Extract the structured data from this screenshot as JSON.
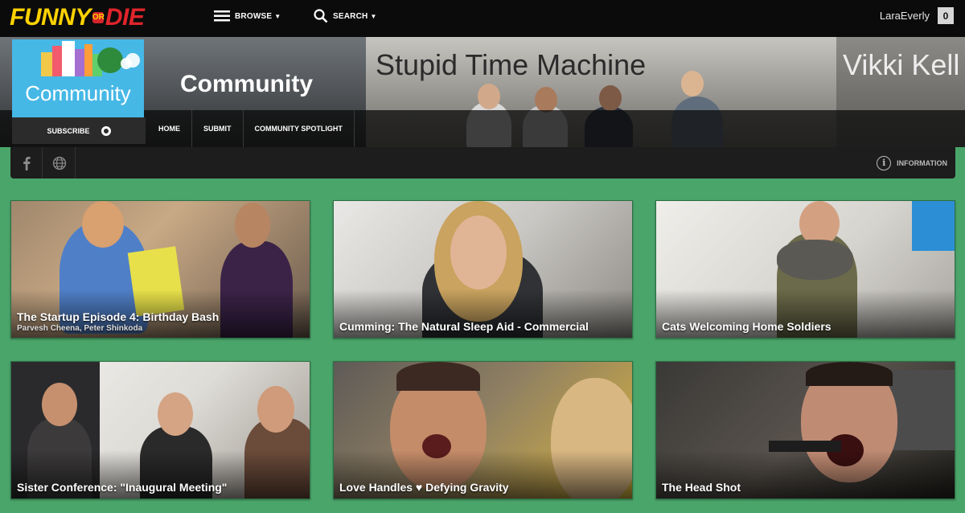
{
  "header": {
    "logo_funny": "FUNNY",
    "logo_or": "OR",
    "logo_die": "DIE",
    "browse_label": "BROWSE",
    "search_label": "SEARCH",
    "username": "LaraEverly",
    "notification_count": "0"
  },
  "banner": {
    "title_main": "Stupid Time Machine",
    "title_partial": "Vikki Kell"
  },
  "community": {
    "avatar_label": "Community",
    "title": "Community",
    "subscribe_label": "SUBSCRIBE",
    "nav": [
      "HOME",
      "SUBMIT",
      "COMMUNITY SPOTLIGHT"
    ],
    "info_label": "INFORMATION"
  },
  "videos": [
    {
      "title": "The Startup Episode 4: Birthday Bash",
      "credits": "Parvesh Cheena, Peter Shinkoda"
    },
    {
      "title": "Cumming: The Natural Sleep Aid - Commercial"
    },
    {
      "title": "Cats Welcoming Home Soldiers"
    },
    {
      "title": "Sister Conference: \"Inaugural Meeting\""
    },
    {
      "title": "Love Handles ♥ Defying Gravity"
    },
    {
      "title": "The Head Shot"
    }
  ],
  "colors": {
    "background": "#4aa56a",
    "topbar": "#0b0b0b",
    "logo_yellow": "#ffd200",
    "logo_red": "#e0242b",
    "avatar_blue": "#46b8e6"
  }
}
